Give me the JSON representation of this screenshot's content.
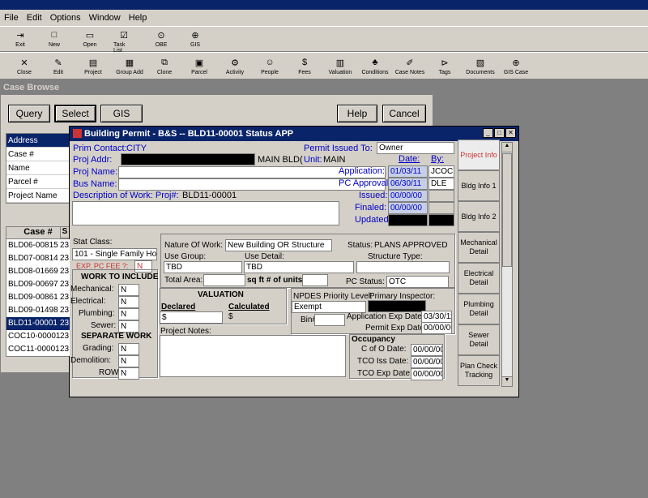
{
  "menu": [
    "File",
    "Edit",
    "Options",
    "Window",
    "Help"
  ],
  "toolbar1": [
    {
      "label": "Exit",
      "icon": "exit-icon",
      "glyph": "⇥"
    },
    {
      "label": "New",
      "icon": "new-icon",
      "glyph": "□"
    },
    {
      "label": "Open",
      "icon": "open-icon",
      "glyph": "▭"
    },
    {
      "label": "Task List",
      "icon": "tasklist-icon",
      "glyph": "☑"
    },
    {
      "label": "OBE",
      "icon": "binoculars-icon",
      "glyph": "⊙"
    },
    {
      "label": "GIS",
      "icon": "globe-icon",
      "glyph": "⊕"
    }
  ],
  "toolbar2": [
    {
      "label": "Close",
      "icon": "close-icon",
      "glyph": "✕"
    },
    {
      "label": "Edit",
      "icon": "edit-icon",
      "glyph": "✎"
    },
    {
      "label": "Project",
      "icon": "project-icon",
      "glyph": "▤"
    },
    {
      "label": "Group Add",
      "icon": "group-add-icon",
      "glyph": "▦"
    },
    {
      "label": "Clone",
      "icon": "clone-icon",
      "glyph": "⧉"
    },
    {
      "label": "Parcel",
      "icon": "parcel-icon",
      "glyph": "▣"
    },
    {
      "label": "Activity",
      "icon": "activity-icon",
      "glyph": "⚙"
    },
    {
      "label": "People",
      "icon": "people-icon",
      "glyph": "☺"
    },
    {
      "label": "Fees",
      "icon": "fees-icon",
      "glyph": "$"
    },
    {
      "label": "Valuation",
      "icon": "valuation-icon",
      "glyph": "▥"
    },
    {
      "label": "Conditions",
      "icon": "conditions-icon",
      "glyph": "♣"
    },
    {
      "label": "Case Notes",
      "icon": "case-notes-icon",
      "glyph": "✐"
    },
    {
      "label": "Tags",
      "icon": "tags-icon",
      "glyph": "⊳"
    },
    {
      "label": "Documents",
      "icon": "documents-icon",
      "glyph": "▧"
    },
    {
      "label": "GIS Case",
      "icon": "gis-case-icon",
      "glyph": "⊕"
    }
  ],
  "case_browse": {
    "title": "Case Browse",
    "buttons": {
      "query": "Query",
      "select": "Select",
      "gis": "GIS",
      "help": "Help",
      "cancel": "Cancel"
    },
    "search_labels": [
      "Address",
      "Case #",
      "Name",
      "Parcel #",
      "Project Name"
    ],
    "list_header": "Case #",
    "list_header_2": "S",
    "cases": [
      "BLD06-00815",
      "BLD07-00814",
      "BLD08-01669",
      "BLD09-00697",
      "BLD09-00861",
      "BLD09-01498",
      "BLD11-00001",
      "COC10-00001",
      "COC11-00001"
    ],
    "case_suffix": "23",
    "selected_case": "BLD11-00001"
  },
  "permit": {
    "title": "Building Permit - B&S  -- BLD11-00001    Status APP",
    "prim_contact_label": "Prim Contact:",
    "prim_contact": "CITY",
    "proj_addr_label": "Proj Addr:",
    "proj_addr_value": "MAIN BLD(",
    "proj_name_label": "Proj Name:",
    "bus_name_label": "Bus Name:",
    "desc_label": "Description of Work: Proj#:",
    "proj_num": "BLD11-00001",
    "permit_issued_to_label": "Permit Issued To:",
    "permit_issued_to": "Owner",
    "unit_label": "Unit:",
    "unit": "MAIN",
    "date_header": "Date:",
    "by_header": "By:",
    "dates": [
      {
        "label": "Application:",
        "date": "01/03/11",
        "by": "JCOC"
      },
      {
        "label": "PC Approval:",
        "date": "06/30/11",
        "by": "DLE"
      },
      {
        "label": "Issued:",
        "date": "00/00/00",
        "by": ""
      },
      {
        "label": "Finaled:",
        "date": "00/00/00",
        "by": ""
      },
      {
        "label": "Updated:",
        "date": "",
        "by": ""
      }
    ],
    "stat_class_label": "Stat Class:",
    "stat_class": "101 - Single Family Hous",
    "exp_pc_fee_label": "EXP. PC FEE ?:",
    "exp_pc_fee": "N",
    "work_to_include": "WORK TO INCLUDE",
    "work_items": [
      {
        "label": "Mechanical:",
        "value": "N"
      },
      {
        "label": "Electrical:",
        "value": "N"
      },
      {
        "label": "Plumbing:",
        "value": "N"
      },
      {
        "label": "Sewer:",
        "value": "N"
      }
    ],
    "separate_work": "SEPARATE WORK",
    "separate_items": [
      {
        "label": "Grading:",
        "value": "N"
      },
      {
        "label": "Demolition:",
        "value": "N"
      },
      {
        "label": "ROW:",
        "value": "N"
      }
    ],
    "nature_label": "Nature Of Work:",
    "nature": "New Building OR Structure",
    "status_label": "Status:",
    "status": "PLANS APPROVED",
    "use_group_label": "Use Group:",
    "use_group": "TBD",
    "use_detail_label": "Use Detail:",
    "use_detail": "TBD",
    "structure_type_label": "Structure Type:",
    "total_area_label": "Total Area:",
    "sqft_label": "sq ft # of units:",
    "pc_status_label": "PC Status:",
    "pc_status": "OTC",
    "valuation_title": "VALUATION",
    "declared_label": "Declared",
    "calculated_label": "Calculated",
    "declared": "$",
    "calculated": "$",
    "npdes_label": "NPDES Priority Level:",
    "npdes": "Exempt",
    "primary_inspector_label": "Primary Inspector:",
    "bin_label": "Bin#",
    "app_exp_label": "Application Exp Date:",
    "app_exp": "03/30/11",
    "permit_exp_label": "Permit Exp Date:",
    "permit_exp": "00/00/00",
    "project_notes_label": "Project Notes:",
    "occupancy_title": "Occupancy",
    "occupancy": [
      {
        "label": "C of O Date:",
        "value": "00/00/00"
      },
      {
        "label": "TCO Iss Date:",
        "value": "00/00/00"
      },
      {
        "label": "TCO Exp Date:",
        "value": "00/00/00"
      }
    ],
    "tabs": [
      "Project Info",
      "Bldg Info 1",
      "Bldg Info 2",
      "Mechanical Detail",
      "Electrical Detail",
      "Plumbing Detail",
      "Sewer Detail",
      "Plan Check Tracking"
    ]
  }
}
